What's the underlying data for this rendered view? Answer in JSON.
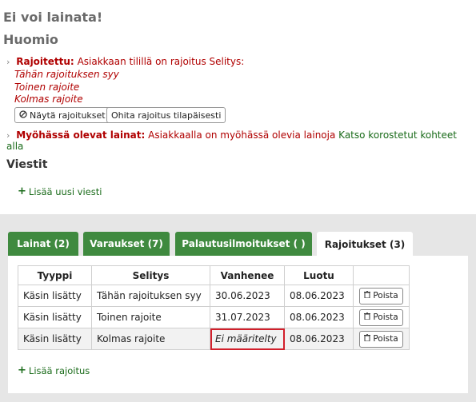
{
  "header": {
    "title": "Ei voi lainata!",
    "subtitle": "Huomio"
  },
  "restriction_alert": {
    "label": "Rajoitettu:",
    "text": "Asiakkaan tilillä on rajoitus Selitys:",
    "items": [
      "Tähän rajoituksen syy",
      "Toinen rajoite",
      "Kolmas rajoite"
    ],
    "show_button": "Näytä rajoitukset",
    "override_button": "Ohita rajoitus tilapäisesti"
  },
  "overdue_alert": {
    "label": "Myöhässä olevat lainat:",
    "text": "Asiakkaalla on myöhässä olevia lainoja",
    "link": "Katso korostetut kohteet alla"
  },
  "messages": {
    "title": "Viestit",
    "add_label": "Lisää uusi viesti"
  },
  "tabs": [
    {
      "label": "Lainat (2)",
      "active": false
    },
    {
      "label": "Varaukset (7)",
      "active": false
    },
    {
      "label": "Palautusilmoitukset ( )",
      "active": false
    },
    {
      "label": "Rajoitukset (3)",
      "active": true
    }
  ],
  "restrictions_table": {
    "headers": [
      "Tyyppi",
      "Selitys",
      "Vanhenee",
      "Luotu",
      ""
    ],
    "rows": [
      {
        "type": "Käsin lisätty",
        "comment": "Tähän rajoituksen syy",
        "expires": "30.06.2023",
        "created": "08.06.2023",
        "action": "Poista"
      },
      {
        "type": "Käsin lisätty",
        "comment": "Toinen rajoite",
        "expires": "31.07.2023",
        "created": "08.06.2023",
        "action": "Poista"
      },
      {
        "type": "Käsin lisätty",
        "comment": "Kolmas rajoite",
        "expires": "Ei määritelty",
        "created": "08.06.2023",
        "action": "Poista"
      }
    ],
    "add_label": "Lisää rajoitus"
  },
  "colors": {
    "tab_green": "#3f8a3f",
    "alert_red": "#b00000",
    "link_green": "#1a6b1a",
    "highlight_red": "#d21f2b"
  }
}
